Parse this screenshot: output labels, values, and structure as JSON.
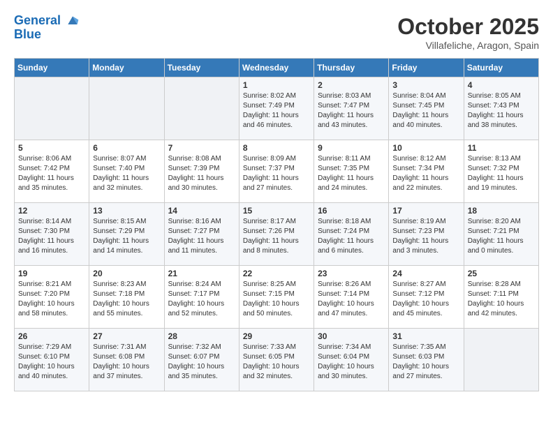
{
  "header": {
    "logo_line1": "General",
    "logo_line2": "Blue",
    "month": "October 2025",
    "location": "Villafeliche, Aragon, Spain"
  },
  "days_of_week": [
    "Sunday",
    "Monday",
    "Tuesday",
    "Wednesday",
    "Thursday",
    "Friday",
    "Saturday"
  ],
  "weeks": [
    [
      {
        "day": "",
        "info": ""
      },
      {
        "day": "",
        "info": ""
      },
      {
        "day": "",
        "info": ""
      },
      {
        "day": "1",
        "info": "Sunrise: 8:02 AM\nSunset: 7:49 PM\nDaylight: 11 hours\nand 46 minutes."
      },
      {
        "day": "2",
        "info": "Sunrise: 8:03 AM\nSunset: 7:47 PM\nDaylight: 11 hours\nand 43 minutes."
      },
      {
        "day": "3",
        "info": "Sunrise: 8:04 AM\nSunset: 7:45 PM\nDaylight: 11 hours\nand 40 minutes."
      },
      {
        "day": "4",
        "info": "Sunrise: 8:05 AM\nSunset: 7:43 PM\nDaylight: 11 hours\nand 38 minutes."
      }
    ],
    [
      {
        "day": "5",
        "info": "Sunrise: 8:06 AM\nSunset: 7:42 PM\nDaylight: 11 hours\nand 35 minutes."
      },
      {
        "day": "6",
        "info": "Sunrise: 8:07 AM\nSunset: 7:40 PM\nDaylight: 11 hours\nand 32 minutes."
      },
      {
        "day": "7",
        "info": "Sunrise: 8:08 AM\nSunset: 7:39 PM\nDaylight: 11 hours\nand 30 minutes."
      },
      {
        "day": "8",
        "info": "Sunrise: 8:09 AM\nSunset: 7:37 PM\nDaylight: 11 hours\nand 27 minutes."
      },
      {
        "day": "9",
        "info": "Sunrise: 8:11 AM\nSunset: 7:35 PM\nDaylight: 11 hours\nand 24 minutes."
      },
      {
        "day": "10",
        "info": "Sunrise: 8:12 AM\nSunset: 7:34 PM\nDaylight: 11 hours\nand 22 minutes."
      },
      {
        "day": "11",
        "info": "Sunrise: 8:13 AM\nSunset: 7:32 PM\nDaylight: 11 hours\nand 19 minutes."
      }
    ],
    [
      {
        "day": "12",
        "info": "Sunrise: 8:14 AM\nSunset: 7:30 PM\nDaylight: 11 hours\nand 16 minutes."
      },
      {
        "day": "13",
        "info": "Sunrise: 8:15 AM\nSunset: 7:29 PM\nDaylight: 11 hours\nand 14 minutes."
      },
      {
        "day": "14",
        "info": "Sunrise: 8:16 AM\nSunset: 7:27 PM\nDaylight: 11 hours\nand 11 minutes."
      },
      {
        "day": "15",
        "info": "Sunrise: 8:17 AM\nSunset: 7:26 PM\nDaylight: 11 hours\nand 8 minutes."
      },
      {
        "day": "16",
        "info": "Sunrise: 8:18 AM\nSunset: 7:24 PM\nDaylight: 11 hours\nand 6 minutes."
      },
      {
        "day": "17",
        "info": "Sunrise: 8:19 AM\nSunset: 7:23 PM\nDaylight: 11 hours\nand 3 minutes."
      },
      {
        "day": "18",
        "info": "Sunrise: 8:20 AM\nSunset: 7:21 PM\nDaylight: 11 hours\nand 0 minutes."
      }
    ],
    [
      {
        "day": "19",
        "info": "Sunrise: 8:21 AM\nSunset: 7:20 PM\nDaylight: 10 hours\nand 58 minutes."
      },
      {
        "day": "20",
        "info": "Sunrise: 8:23 AM\nSunset: 7:18 PM\nDaylight: 10 hours\nand 55 minutes."
      },
      {
        "day": "21",
        "info": "Sunrise: 8:24 AM\nSunset: 7:17 PM\nDaylight: 10 hours\nand 52 minutes."
      },
      {
        "day": "22",
        "info": "Sunrise: 8:25 AM\nSunset: 7:15 PM\nDaylight: 10 hours\nand 50 minutes."
      },
      {
        "day": "23",
        "info": "Sunrise: 8:26 AM\nSunset: 7:14 PM\nDaylight: 10 hours\nand 47 minutes."
      },
      {
        "day": "24",
        "info": "Sunrise: 8:27 AM\nSunset: 7:12 PM\nDaylight: 10 hours\nand 45 minutes."
      },
      {
        "day": "25",
        "info": "Sunrise: 8:28 AM\nSunset: 7:11 PM\nDaylight: 10 hours\nand 42 minutes."
      }
    ],
    [
      {
        "day": "26",
        "info": "Sunrise: 7:29 AM\nSunset: 6:10 PM\nDaylight: 10 hours\nand 40 minutes."
      },
      {
        "day": "27",
        "info": "Sunrise: 7:31 AM\nSunset: 6:08 PM\nDaylight: 10 hours\nand 37 minutes."
      },
      {
        "day": "28",
        "info": "Sunrise: 7:32 AM\nSunset: 6:07 PM\nDaylight: 10 hours\nand 35 minutes."
      },
      {
        "day": "29",
        "info": "Sunrise: 7:33 AM\nSunset: 6:05 PM\nDaylight: 10 hours\nand 32 minutes."
      },
      {
        "day": "30",
        "info": "Sunrise: 7:34 AM\nSunset: 6:04 PM\nDaylight: 10 hours\nand 30 minutes."
      },
      {
        "day": "31",
        "info": "Sunrise: 7:35 AM\nSunset: 6:03 PM\nDaylight: 10 hours\nand 27 minutes."
      },
      {
        "day": "",
        "info": ""
      }
    ]
  ]
}
